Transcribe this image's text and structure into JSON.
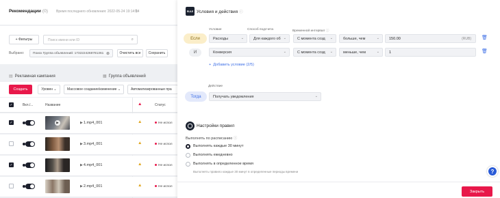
{
  "header": {
    "title": "Рекомендации",
    "count": "(0)",
    "updated": "Время последнего обновления: 2022-05-24 19:14:24"
  },
  "toolbar": {
    "filters_label": "+ Фильтры",
    "search_placeholder": "Поиск имени или ID",
    "selected_label": "Выбрано:",
    "selected_chip": "Поиск Группа объявлений: 1732224268781361",
    "clear_all_label": "Очистить все",
    "save_label": "Сохранить"
  },
  "tabs": {
    "campaigns": "Рекламная кампания",
    "ad_groups": "Группа объявлений"
  },
  "actions": {
    "create_label": "Создать",
    "level_label": "Уровен",
    "bulk_label": "Массовое создание/изменение",
    "auto_label": "Автоматизированные пра"
  },
  "table": {
    "col_toggle": "Вкл./...",
    "col_name": "Название",
    "col_status": "Статус",
    "rows": [
      {
        "name": "1.mp4_001",
        "status": "Не испол",
        "checked": true
      },
      {
        "name": "3.mp4_001",
        "status": "Не испол",
        "checked": false
      },
      {
        "name": "4.mp4_001",
        "status": "Не испол",
        "checked": true
      },
      {
        "name": "2.mp4_001",
        "status": "Не испол",
        "checked": false
      }
    ]
  },
  "drawer": {
    "logo_text": "RULE",
    "title": "Условия и действия",
    "col_condition": "Условие",
    "col_method": "Способ подсчета",
    "col_interval": "Временной интервал",
    "if_label": "Если",
    "and_label": "И",
    "cond1": {
      "metric": "Расходы",
      "method": "Для каждого об",
      "interval": "С момента созд",
      "op": "больше, чем",
      "value": "150.00",
      "unit": "(RUB)"
    },
    "cond2": {
      "metric": "Конверсия",
      "interval": "С момента созд",
      "op": "меньше, чем",
      "value": "1"
    },
    "add_condition": "Добавить условие (2/5)",
    "action_label": "Действие",
    "then_label": "Тогда",
    "action_value": "Получать уведомления",
    "settings_title": "Настройки правил",
    "schedule_label": "Выполнять по расписанию",
    "options": [
      "Выполнять каждые 30 минут",
      "Выполнять ежедневно",
      "Выполнять в определенное время"
    ],
    "hint": "Выполнять правило каждые 30 минут в определенные периоды времени",
    "close_label": "Закрыть",
    "help_icon_label": "?"
  },
  "colors": {
    "accent": "#e8184a",
    "link": "#3c6ee6",
    "dark": "#1b1e2b"
  }
}
